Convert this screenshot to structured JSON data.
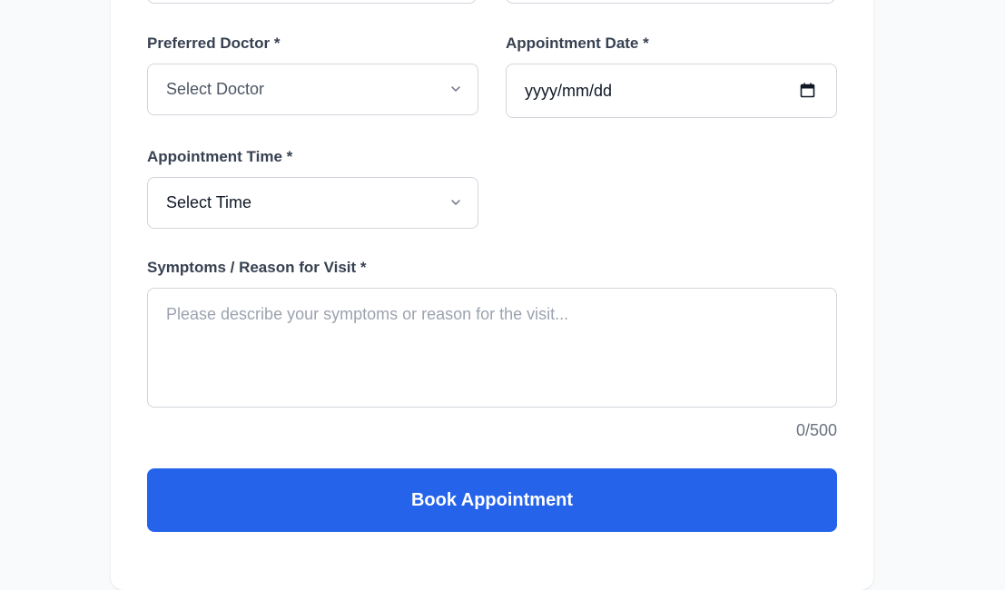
{
  "form": {
    "doctor": {
      "label": "Preferred Doctor *",
      "value": "Select Doctor",
      "value_color": "#4b5563"
    },
    "date": {
      "label": "Appointment Date *",
      "value": "yyyy/mm/dd"
    },
    "time": {
      "label": "Appointment Time *",
      "value": "Select Time"
    },
    "symptoms": {
      "label": "Symptoms / Reason for Visit *",
      "placeholder": "Please describe your symptoms or reason for the visit...",
      "char_count": "0/500"
    },
    "submit_label": "Book Appointment"
  },
  "icons": {
    "select_arrow": "chevron-down-icon",
    "date_picker": "calendar-icon"
  },
  "colors": {
    "primary": "#2563eb",
    "border": "#d1d5db",
    "label": "#374151",
    "placeholder": "#9ca3af",
    "page_background": "#f8fafc"
  }
}
